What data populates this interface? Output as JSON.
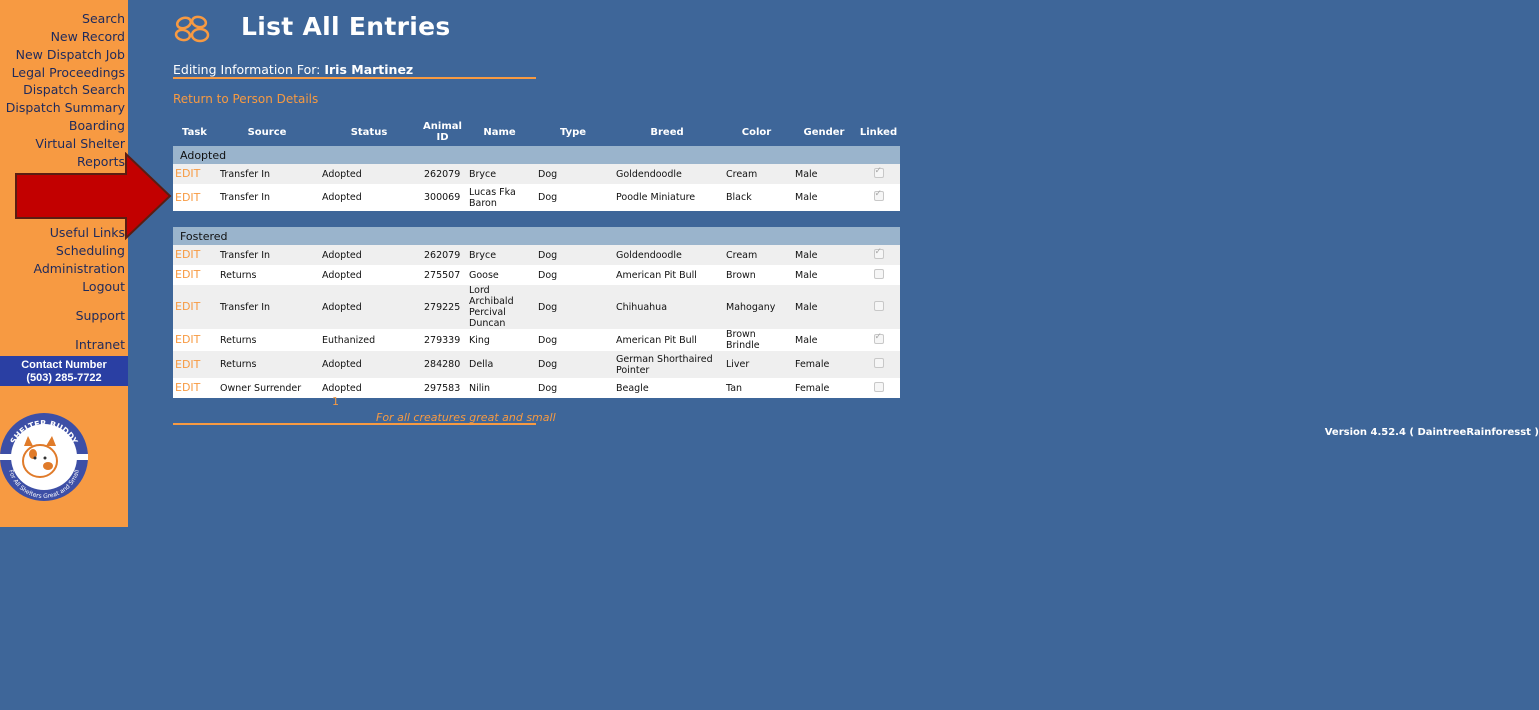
{
  "nav": {
    "items": [
      {
        "label": "Search"
      },
      {
        "label": "New Record"
      },
      {
        "label": "New Dispatch Job"
      },
      {
        "label": "Legal Proceedings"
      },
      {
        "label": "Dispatch Search"
      },
      {
        "label": "Dispatch Summary"
      },
      {
        "label": "Boarding"
      },
      {
        "label": "Virtual Shelter"
      },
      {
        "label": "Reports"
      },
      {
        "label": "Useful Links"
      },
      {
        "label": "Scheduling"
      },
      {
        "label": "Administration"
      },
      {
        "label": "Logout"
      },
      {
        "label": "Support"
      },
      {
        "label": "Intranet"
      }
    ]
  },
  "contact": {
    "label": "Contact Number",
    "phone": "(503) 285-7722"
  },
  "logo": {
    "ring_text": "SHELTER BUDDY",
    "ring_tagline": "For All Shelters Great and Small"
  },
  "page": {
    "title": "List All Entries",
    "editing_label": "Editing Information For:",
    "person_name": "Iris Martinez",
    "return_link": "Return to Person Details",
    "pager": "1",
    "tagline": "For all creatures great and small",
    "version": "Version 4.52.4 ( DaintreeRainforesst )"
  },
  "table": {
    "headers": {
      "task": "Task",
      "source": "Source",
      "status": "Status",
      "animal_id_1": "Animal",
      "animal_id_2": "ID",
      "name": "Name",
      "type": "Type",
      "breed": "Breed",
      "color": "Color",
      "gender": "Gender",
      "linked": "Linked"
    },
    "edit_label": "EDIT",
    "groups": [
      {
        "title": "Adopted",
        "rows": [
          {
            "source": "Transfer In",
            "status": "Adopted",
            "animal_id": "262079",
            "name": "Bryce",
            "type": "Dog",
            "breed": "Goldendoodle",
            "color": "Cream",
            "gender": "Male",
            "linked": true
          },
          {
            "source": "Transfer In",
            "status": "Adopted",
            "animal_id": "300069",
            "name": "Lucas Fka Baron",
            "type": "Dog",
            "breed": "Poodle Miniature",
            "color": "Black",
            "gender": "Male",
            "linked": true
          }
        ]
      },
      {
        "title": "Fostered",
        "rows": [
          {
            "source": "Transfer In",
            "status": "Adopted",
            "animal_id": "262079",
            "name": "Bryce",
            "type": "Dog",
            "breed": "Goldendoodle",
            "color": "Cream",
            "gender": "Male",
            "linked": true
          },
          {
            "source": "Returns",
            "status": "Adopted",
            "animal_id": "275507",
            "name": "Goose",
            "type": "Dog",
            "breed": "American Pit Bull",
            "color": "Brown",
            "gender": "Male",
            "linked": false
          },
          {
            "source": "Transfer In",
            "status": "Adopted",
            "animal_id": "279225",
            "name": "Lord Archibald Percival Duncan",
            "type": "Dog",
            "breed": "Chihuahua",
            "color": "Mahogany",
            "gender": "Male",
            "linked": false
          },
          {
            "source": "Returns",
            "status": "Euthanized",
            "animal_id": "279339",
            "name": "King",
            "type": "Dog",
            "breed": "American Pit Bull",
            "color": "Brown Brindle",
            "gender": "Male",
            "linked": true
          },
          {
            "source": "Returns",
            "status": "Adopted",
            "animal_id": "284280",
            "name": "Della",
            "type": "Dog",
            "breed": "German Shorthaired Pointer",
            "color": "Liver",
            "gender": "Female",
            "linked": false
          },
          {
            "source": "Owner Surrender",
            "status": "Adopted",
            "animal_id": "297583",
            "name": "Nilin",
            "type": "Dog",
            "breed": "Beagle",
            "color": "Tan",
            "gender": "Female",
            "linked": false
          }
        ]
      }
    ]
  },
  "colors": {
    "background": "#3e6699",
    "sidebar": "#f79a42",
    "accent_orange": "#f79a42",
    "group_header": "#9ab4cc",
    "contact_box": "#2a3fa3",
    "arrow_red": "#c20000"
  },
  "icons": {
    "brand": "pawprint-icon",
    "annotation": "red-arrow-icon"
  }
}
